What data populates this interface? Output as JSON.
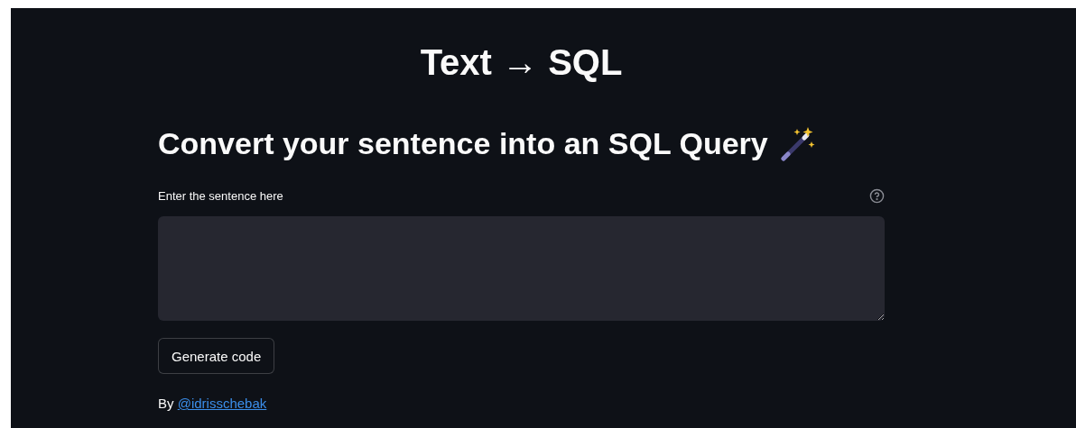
{
  "title": "Text → SQL",
  "heading": "Convert your sentence into an SQL Query",
  "input": {
    "label": "Enter the sentence here"
  },
  "button": "Generate code",
  "credit": {
    "prefix": "By",
    "link": "@idrisschebak"
  }
}
